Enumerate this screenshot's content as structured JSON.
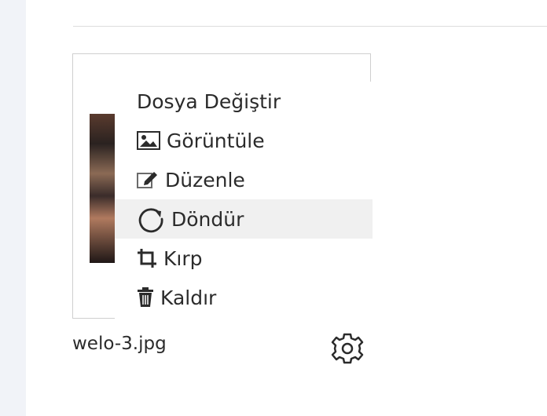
{
  "menu": {
    "items": [
      {
        "label": "Dosya Değiştir",
        "icon": ""
      },
      {
        "label": "Görüntüle",
        "icon": "image-icon"
      },
      {
        "label": "Düzenle",
        "icon": "edit-icon"
      },
      {
        "label": "Döndür",
        "icon": "rotate-icon"
      },
      {
        "label": "Kırp",
        "icon": "crop-icon"
      },
      {
        "label": "Kaldır",
        "icon": "trash-icon"
      }
    ],
    "active_label": "Döndür"
  },
  "file": {
    "name": "welo-3.jpg",
    "settings_icon": "gear-icon"
  },
  "colors": {
    "text": "#2b2b2b",
    "border": "#cfcfcf",
    "hover": "#f0f0f0",
    "left_gutter": "#f1f3f8"
  }
}
